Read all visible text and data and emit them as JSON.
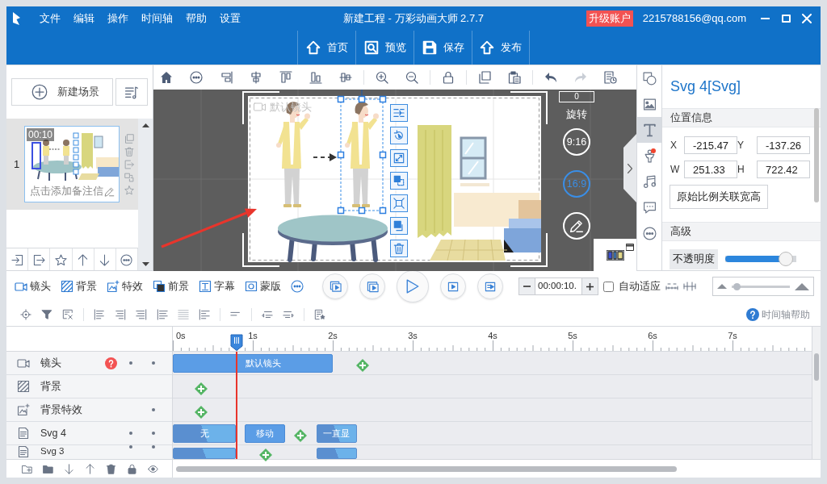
{
  "window": {
    "title": "新建工程 - 万彩动画大师 2.7.7",
    "menu": [
      "文件",
      "编辑",
      "操作",
      "时间轴",
      "帮助",
      "设置"
    ],
    "upgrade_button": "升级账户",
    "account": "2215788156@qq.com"
  },
  "main_toolbar": [
    "首页",
    "预览",
    "保存",
    "发布"
  ],
  "scene_panel": {
    "new_scene_button": "新建场景",
    "scenes": [
      {
        "number": "1",
        "duration": "00:10",
        "note": "点击添加备注信",
        "selected": true
      }
    ]
  },
  "canvas": {
    "camera_label": "默认镜头",
    "rotation": "0",
    "rotation_label": "旋转",
    "aspect_ratios": [
      {
        "label": "9:16",
        "selected": false
      },
      {
        "label": "16:9",
        "selected": true
      }
    ]
  },
  "side_tabs": [
    {
      "selected": false,
      "notification": false
    },
    {
      "selected": false,
      "notification": false
    },
    {
      "selected": true,
      "notification": false
    },
    {
      "selected": false,
      "notification": true
    },
    {
      "selected": false,
      "notification": false
    },
    {
      "selected": false,
      "notification": false
    },
    {
      "selected": false,
      "notification": false
    }
  ],
  "properties": {
    "title": "Svg 4[Svg]",
    "position_section": "位置信息",
    "fields": [
      {
        "label": "X",
        "value": "-215.47"
      },
      {
        "label": "Y",
        "value": "-137.26"
      },
      {
        "label": "W",
        "value": "251.33"
      },
      {
        "label": "H",
        "value": "722.42"
      }
    ],
    "ratio_button": "原始比例关联宽高",
    "advanced_section": "高级",
    "opacity": {
      "label": "不透明度",
      "level": 0.85
    }
  },
  "timeline_toolbar": {
    "layers": [
      "镜头",
      "背景",
      "特效",
      "前景",
      "字幕",
      "蒙版"
    ],
    "time": "00:00:10.",
    "auto_fit": {
      "label": "自动适应",
      "checked": false
    },
    "zoom": {
      "level": 0.08
    },
    "help": "时间轴帮助"
  },
  "timeline": {
    "ruler": [
      "0s",
      "1s",
      "2s",
      "3s",
      "4s",
      "5s",
      "6s",
      "7s"
    ],
    "playhead": {
      "level": 0.1
    },
    "tracks": [
      {
        "kind": "camera",
        "name": "镜头",
        "help": true,
        "marks": [
          true,
          true
        ],
        "items": [
          {
            "kind": "clip",
            "label": "默认镜头"
          },
          {
            "kind": "keyframe"
          }
        ]
      },
      {
        "kind": "background",
        "name": "背景",
        "help": false,
        "marks": [
          false,
          false
        ],
        "items": [
          {
            "kind": "keyframe"
          }
        ]
      },
      {
        "kind": "effect",
        "name": "背景特效",
        "help": false,
        "marks": [
          false,
          true
        ],
        "items": [
          {
            "kind": "keyframe"
          }
        ]
      },
      {
        "kind": "svg",
        "name": "Svg 4",
        "help": false,
        "marks": [
          true,
          true
        ],
        "items": [
          {
            "kind": "effect",
            "label": "无"
          },
          {
            "kind": "clip",
            "label": "移动"
          },
          {
            "kind": "keyframe"
          },
          {
            "kind": "effect",
            "label": "一直显"
          }
        ]
      },
      {
        "kind": "svg",
        "name": "Svg 3",
        "help": false,
        "marks": [
          true,
          true
        ],
        "items": [
          {
            "kind": "effect"
          },
          {
            "kind": "keyframe"
          },
          {
            "kind": "effect"
          }
        ]
      }
    ]
  }
}
